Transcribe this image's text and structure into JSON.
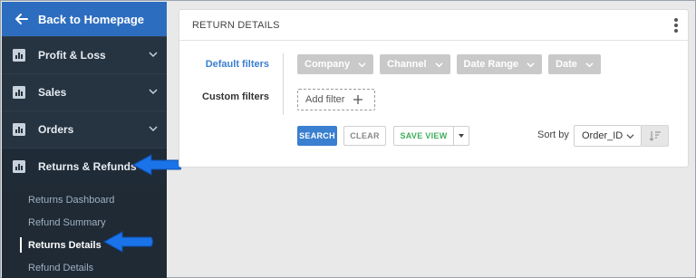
{
  "sidebar": {
    "back_label": "Back to Homepage",
    "items": [
      {
        "label": "Profit & Loss"
      },
      {
        "label": "Sales"
      },
      {
        "label": "Orders"
      },
      {
        "label": "Returns & Refunds"
      }
    ],
    "submenu": [
      {
        "label": "Returns Dashboard"
      },
      {
        "label": "Refund Summary"
      },
      {
        "label": "Returns Details"
      },
      {
        "label": "Refund Details"
      }
    ]
  },
  "panel": {
    "title": "RETURN DETAILS",
    "default_filters_label": "Default filters",
    "custom_filters_label": "Custom filters",
    "filter_chips": [
      {
        "label": "Company"
      },
      {
        "label": "Channel"
      },
      {
        "label": "Date Range"
      },
      {
        "label": "Date"
      }
    ],
    "add_filter_label": "Add filter",
    "search_label": "SEARCH",
    "clear_label": "CLEAR",
    "save_view_label": "SAVE VIEW",
    "sort_by_label": "Sort by",
    "sort_value": "Order_ID"
  },
  "colors": {
    "accent": "#3a7fd0",
    "sidebar_bg": "#263340",
    "back_bg": "#2d6dbf",
    "save_green": "#3fae5c",
    "annotation_arrow": "#1a73e8"
  }
}
